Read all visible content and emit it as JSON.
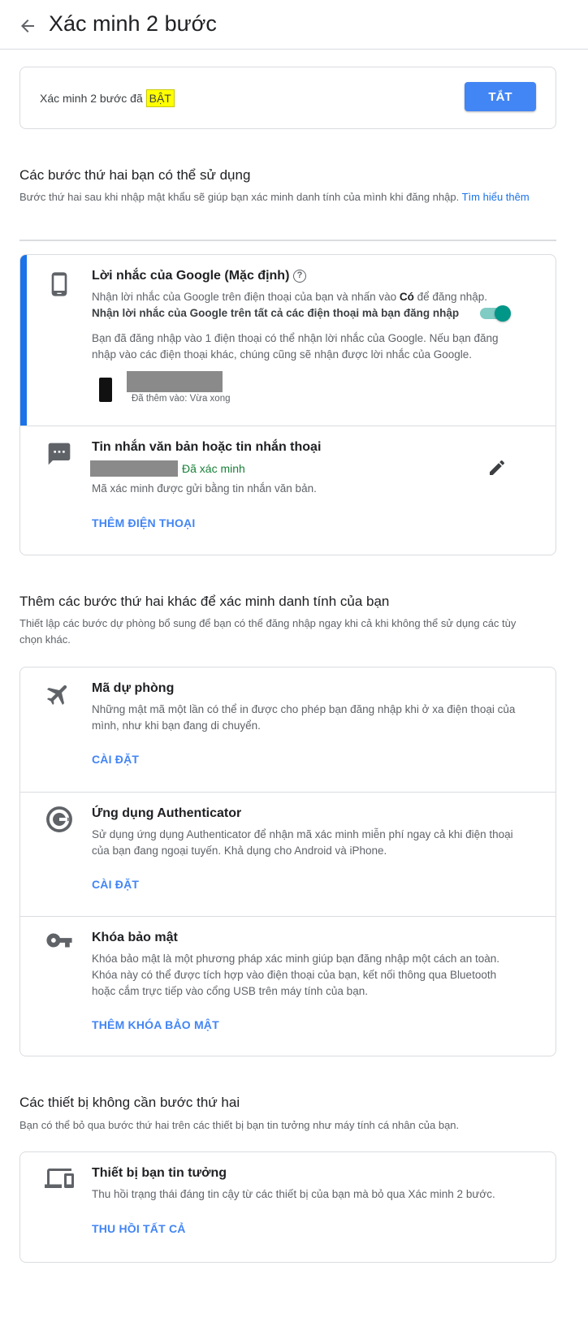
{
  "header": {
    "title": "Xác minh 2 bước",
    "back_icon": "arrow-left-icon"
  },
  "status": {
    "text_prefix": "Xác minh 2 bước đã",
    "state": "BẬT",
    "button_label": "TẮT",
    "button_color": "#4285f4"
  },
  "usable": {
    "title": "Các bước thứ hai bạn có thể sử dụng",
    "desc": "Bước thứ hai sau khi nhập mật khẩu sẽ giúp bạn xác minh danh tính của mình khi đăng nhập.",
    "link": "Tìm hiểu thêm"
  },
  "prompt": {
    "icon": "phone-icon",
    "title": "Lời nhắc của Google (Mặc định)",
    "help_icon": "help-icon",
    "help_glyph": "?",
    "desc_part1": "Nhận lời nhắc của Google trên điện thoại của bạn và nhấn vào",
    "desc_bold": "Có",
    "desc_part2": "để đăng nhập.",
    "toggle_label": "Nhận lời nhắc của Google trên tất cả các điện thoại mà bạn đăng nhập",
    "toggle_on": true,
    "info": "Bạn đã đăng nhập vào 1 điện thoại có thể nhận lời nhắc của Google. Nếu bạn đăng nhập vào các điện thoại khác, chúng cũng sẽ nhận được lời nhắc của Google.",
    "device_added": "Đã thêm vào: Vừa xong",
    "accent_color": "#1a73e8"
  },
  "sms": {
    "icon": "sms-icon",
    "title": "Tin nhắn văn bản hoặc tin nhắn thoại",
    "verified": "Đã xác minh",
    "desc": "Mã xác minh được gửi bằng tin nhắn văn bản.",
    "edit_icon": "edit-icon",
    "action": "THÊM ĐIỆN THOẠI"
  },
  "more": {
    "title": "Thêm các bước thứ hai khác để xác minh danh tính của bạn",
    "desc": "Thiết lập các bước dự phòng bổ sung để bạn có thể đăng nhập ngay khi cả khi không thể sử dụng các tùy chọn khác.",
    "backup": {
      "icon": "airplane-icon",
      "title": "Mã dự phòng",
      "desc": "Những mật mã một lần có thể in được cho phép bạn đăng nhập khi ở xa điện thoại của mình, như khi bạn đang di chuyển.",
      "action": "CÀI ĐẶT"
    },
    "authenticator": {
      "icon": "authenticator-icon",
      "title": "Ứng dụng Authenticator",
      "desc": "Sử dụng ứng dụng Authenticator để nhận mã xác minh miễn phí ngay cả khi điện thoại của bạn đang ngoại tuyến. Khả dụng cho Android và iPhone.",
      "action": "CÀI ĐẶT"
    },
    "security_key": {
      "icon": "key-icon",
      "title": "Khóa bảo mật",
      "desc": "Khóa bảo mật là một phương pháp xác minh giúp bạn đăng nhập một cách an toàn. Khóa này có thể được tích hợp vào điện thoại của bạn, kết nối thông qua Bluetooth hoặc cắm trực tiếp vào cổng USB trên máy tính của bạn.",
      "action": "THÊM KHÓA BẢO MẬT"
    }
  },
  "devices": {
    "title": "Các thiết bị không cần bước thứ hai",
    "desc": "Bạn có thể bỏ qua bước thứ hai trên các thiết bị bạn tin tưởng như máy tính cá nhân của bạn.",
    "trusted": {
      "icon": "devices-icon",
      "title": "Thiết bị bạn tin tưởng",
      "desc": "Thu hồi trạng thái đáng tin cậy từ các thiết bị của bạn mà bỏ qua Xác minh 2 bước.",
      "action": "THU HỒI TẤT CẢ"
    }
  }
}
